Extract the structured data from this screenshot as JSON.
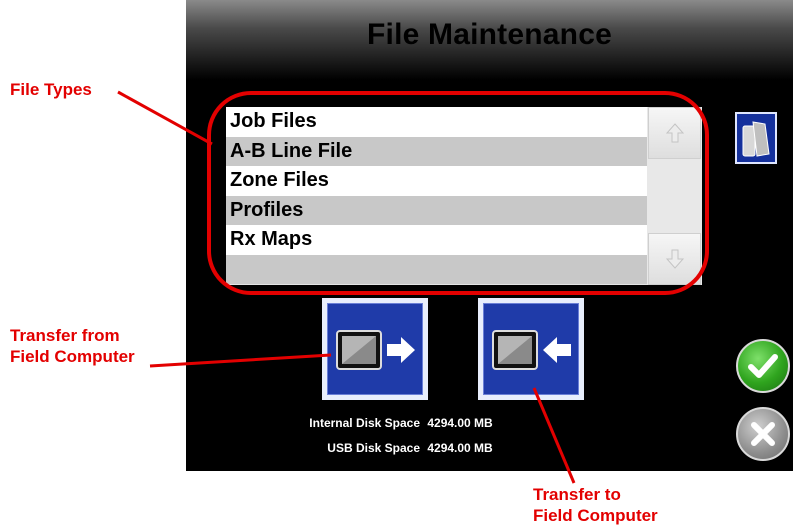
{
  "screen": {
    "title": "File Maintenance",
    "file_list": {
      "items": [
        {
          "label": "Job Files"
        },
        {
          "label": "A-B Line File"
        },
        {
          "label": "Zone Files"
        },
        {
          "label": "Profiles"
        },
        {
          "label": "Rx Maps"
        },
        {
          "label": ""
        }
      ]
    },
    "icons": {
      "scroll_up": "arrow-up-icon",
      "scroll_down": "arrow-down-icon",
      "file_type_button": "file-type-icon",
      "transfer_from": "transfer-from-computer-icon",
      "transfer_to": "transfer-to-computer-icon",
      "accept": "checkmark-icon",
      "cancel": "x-icon"
    },
    "disk": {
      "internal_label": "Internal Disk Space",
      "internal_value": "4294.00 MB",
      "usb_label": "USB Disk Space",
      "usb_value": "4294.00 MB"
    }
  },
  "annotations": {
    "file_types": "File Types",
    "transfer_from_line1": "Transfer from",
    "transfer_from_line2": "Field Computer",
    "transfer_to_line1": "Transfer to",
    "transfer_to_line2": "Field Computer"
  },
  "colors": {
    "annotation_red": "#e30000",
    "button_blue": "#1f3ba9",
    "accept_green": "#2fa41e",
    "screen_bg": "#000000"
  }
}
